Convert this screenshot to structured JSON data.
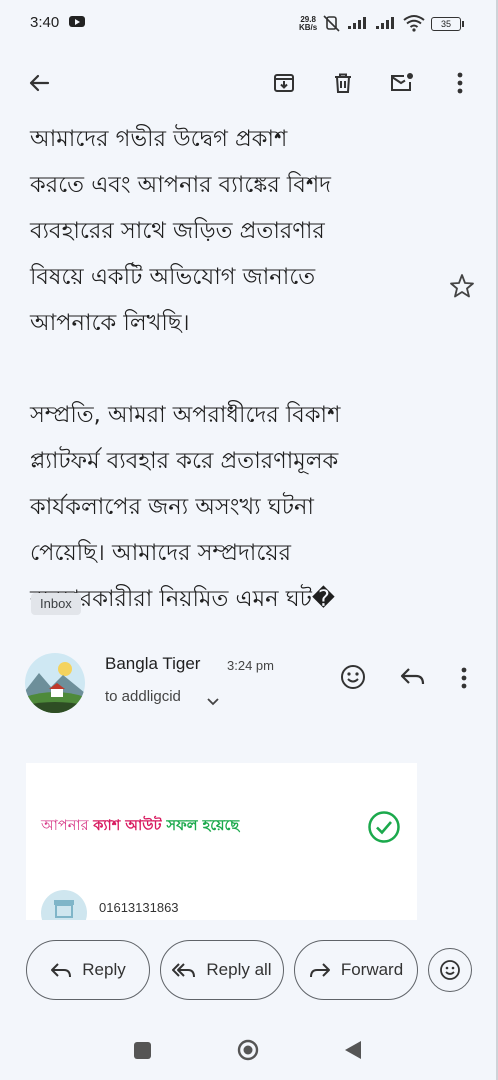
{
  "status_bar": {
    "time": "3:40",
    "speed_value": "29.8",
    "speed_unit": "KB/s",
    "battery": "35"
  },
  "toolbar": {
    "icons": [
      "back-arrow-icon",
      "archive-icon",
      "delete-icon",
      "mark-unread-icon",
      "more-vert-icon"
    ]
  },
  "email": {
    "body": "আমাদের গভীর উদ্বেগ প্রকাশ\nকরতে এবং আপনার ব্যাঙ্কের বিশদ\nব্যবহারের সাথে জড়িত প্রতারণার\nবিষয়ে একটি অভিযোগ জানাতে\nআপনাকে লিখছি।\n\nসম্প্রতি, আমরা অপরাধীদের বিকাশ\nপ্ল্যাটফর্ম ব্যবহার করে প্রতারণামূলক\nকার্যকলাপের জন্য অসংখ্য ঘটনা\nপেয়েছি। আমাদের সম্প্রদায়ের\nব্যবহারকারীরা নিয়মিত এমন ঘট�",
    "label": "Inbox",
    "sender": "Bangla Tiger",
    "time": "3:24 pm",
    "recipient": "to addligcid"
  },
  "card": {
    "msg_part1": "আপনার ",
    "msg_part2": "ক্যাশ আউট ",
    "msg_part3": "সফল হয়েছে",
    "phone": "01613131863",
    "colors": {
      "pink": "#d81b60",
      "green": "#1ba94c"
    }
  },
  "actions": {
    "reply": "Reply",
    "reply_all": "Reply all",
    "forward": "Forward"
  }
}
